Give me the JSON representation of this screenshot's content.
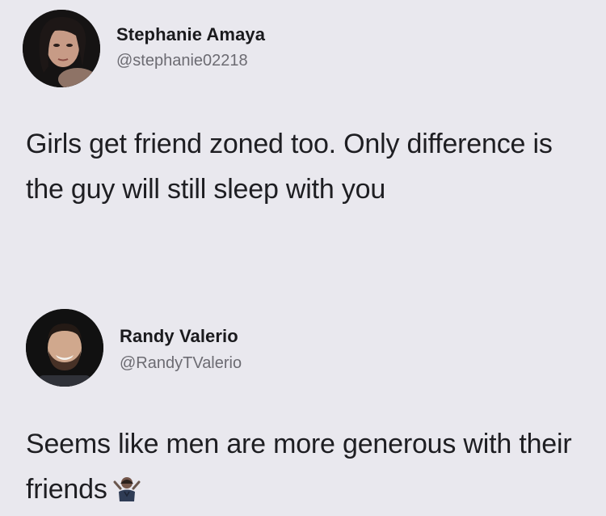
{
  "tweets": [
    {
      "name": "Stephanie Amaya",
      "handle": "@stephanie02218",
      "text": "Girls get friend zoned too. Only difference is the guy will still sleep with you"
    },
    {
      "name": "Randy Valerio",
      "handle": "@RandyTValerio",
      "text": "Seems like men are more generous with their friends",
      "emoji": "man-shrugging-icon"
    }
  ]
}
